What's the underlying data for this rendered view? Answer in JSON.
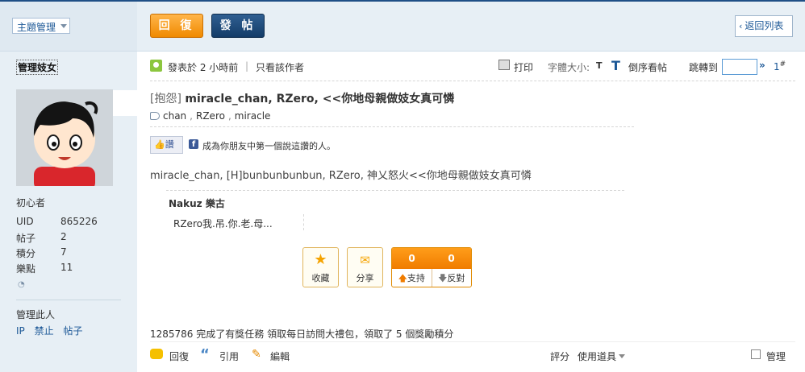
{
  "left": {
    "topic_select": "主題管理",
    "username": "管理妓女",
    "rank": "初心者",
    "stats": [
      {
        "label": "UID",
        "value": "865226"
      },
      {
        "label": "帖子",
        "value": "2"
      },
      {
        "label": "積分",
        "value": "7"
      },
      {
        "label": "樂點",
        "value": "11"
      }
    ],
    "manage_title": "管理此人",
    "manage_links": [
      "IP",
      "禁止",
      "帖子"
    ]
  },
  "toolbar": {
    "reply_label": "回 復",
    "post_label": "發 帖",
    "back_label": "返回列表"
  },
  "meta": {
    "posted": "發表於 2 小時前",
    "separator": "|",
    "only_author": "只看該作者",
    "print": "打印",
    "font_size": "字體大小:",
    "font_small": "T",
    "font_big": "T",
    "reverse": "倒序看帖",
    "jump": "跳轉到",
    "jump_go": "»",
    "floor": "1",
    "floor_mark": "#"
  },
  "post": {
    "title_tag": "[抱怨]",
    "title": "miracle_chan, RZero, <<你地母親做妓女真可憐",
    "tags": [
      "chan",
      "RZero",
      "miracle"
    ],
    "like_label": "讚",
    "like_text": "成為你朋友中第一個說這讚的人。",
    "body": "miracle_chan, [H]bunbunbunbun, RZero, 神乂怒火<<你地母親做妓女真可憐"
  },
  "reply": {
    "name": "Nakuz 樂古",
    "text": "RZero我.吊.你.老.母..."
  },
  "actions": {
    "favorite": "收藏",
    "share": "分享",
    "support_count": "0",
    "oppose_count": "0",
    "support": "支持",
    "oppose": "反對"
  },
  "task_text": "1285786 完成了有獎任務 領取每日訪問大禮包，領取了 5 個獎勵積分",
  "bottom": {
    "reply": "回復",
    "quote": "引用",
    "edit": "編輯",
    "rate": "評分",
    "tools": "使用道具",
    "manage": "管理"
  }
}
